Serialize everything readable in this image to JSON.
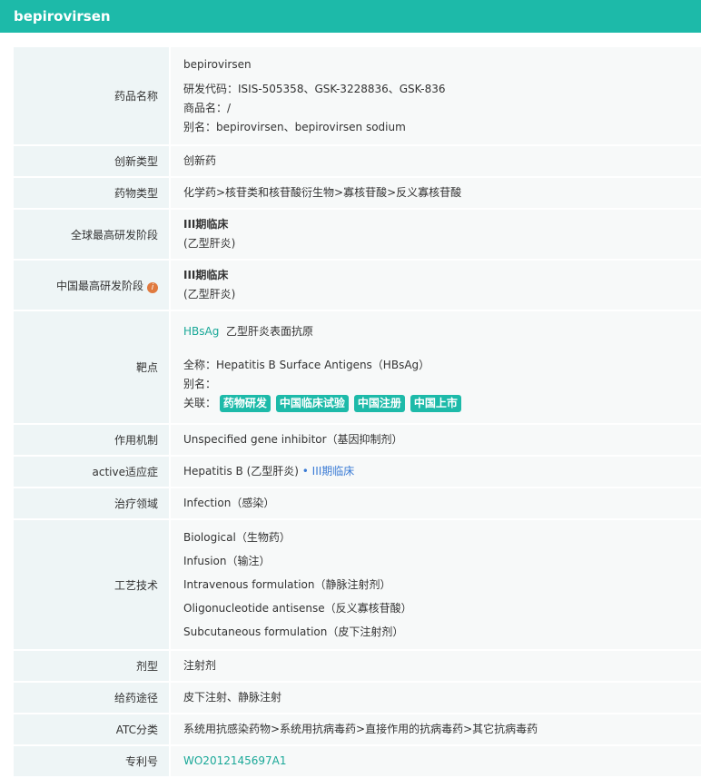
{
  "title": "bepirovirsen",
  "rows": {
    "name": {
      "label": "药品名称",
      "main": "bepirovirsen",
      "code": "研发代码：ISIS-505358、GSK-3228836、GSK-836",
      "trade": "商品名：/",
      "alias": "别名：bepirovirsen、bepirovirsen sodium"
    },
    "innov": {
      "label": "创新类型",
      "value": "创新药"
    },
    "drugtype": {
      "label": "药物类型",
      "value": "化学药>核苷类和核苷酸衍生物>寡核苷酸>反义寡核苷酸"
    },
    "global": {
      "label": "全球最高研发阶段",
      "phase": "III期临床",
      "ind": "(乙型肝炎)"
    },
    "china": {
      "label": "中国最高研发阶段",
      "info_icon": "i",
      "phase": "III期临床",
      "ind": "(乙型肝炎)"
    },
    "target": {
      "label": "靶点",
      "abbr": "HBsAg",
      "cn": "乙型肝炎表面抗原",
      "full": "全称：Hepatitis B Surface Antigens（HBsAg）",
      "alias": "别名：",
      "rel": "关联：",
      "tags": [
        "药物研发",
        "中国临床试验",
        "中国注册",
        "中国上市"
      ]
    },
    "mech": {
      "label": "作用机制",
      "value": "Unspecified gene inhibitor（基因抑制剂）"
    },
    "active": {
      "label": "active适应症",
      "value": "Hepatitis B (乙型肝炎)",
      "phase": "• III期临床"
    },
    "area": {
      "label": "治疗领域",
      "value": "Infection（感染）"
    },
    "tech": {
      "label": "工艺技术",
      "items": [
        "Biological（生物药）",
        "Infusion（输注）",
        "Intravenous formulation（静脉注射剂）",
        "Oligonucleotide antisense（反义寡核苷酸）",
        "Subcutaneous formulation（皮下注射剂）"
      ]
    },
    "form": {
      "label": "剂型",
      "value": "注射剂"
    },
    "route": {
      "label": "给药途径",
      "value": "皮下注射、静脉注射"
    },
    "atc": {
      "label": "ATC分类",
      "value": "系统用抗感染药物>系统用抗病毒药>直接作用的抗病毒药>其它抗病毒药"
    },
    "patent": {
      "label": "专利号",
      "value": "WO2012145697A1"
    }
  }
}
